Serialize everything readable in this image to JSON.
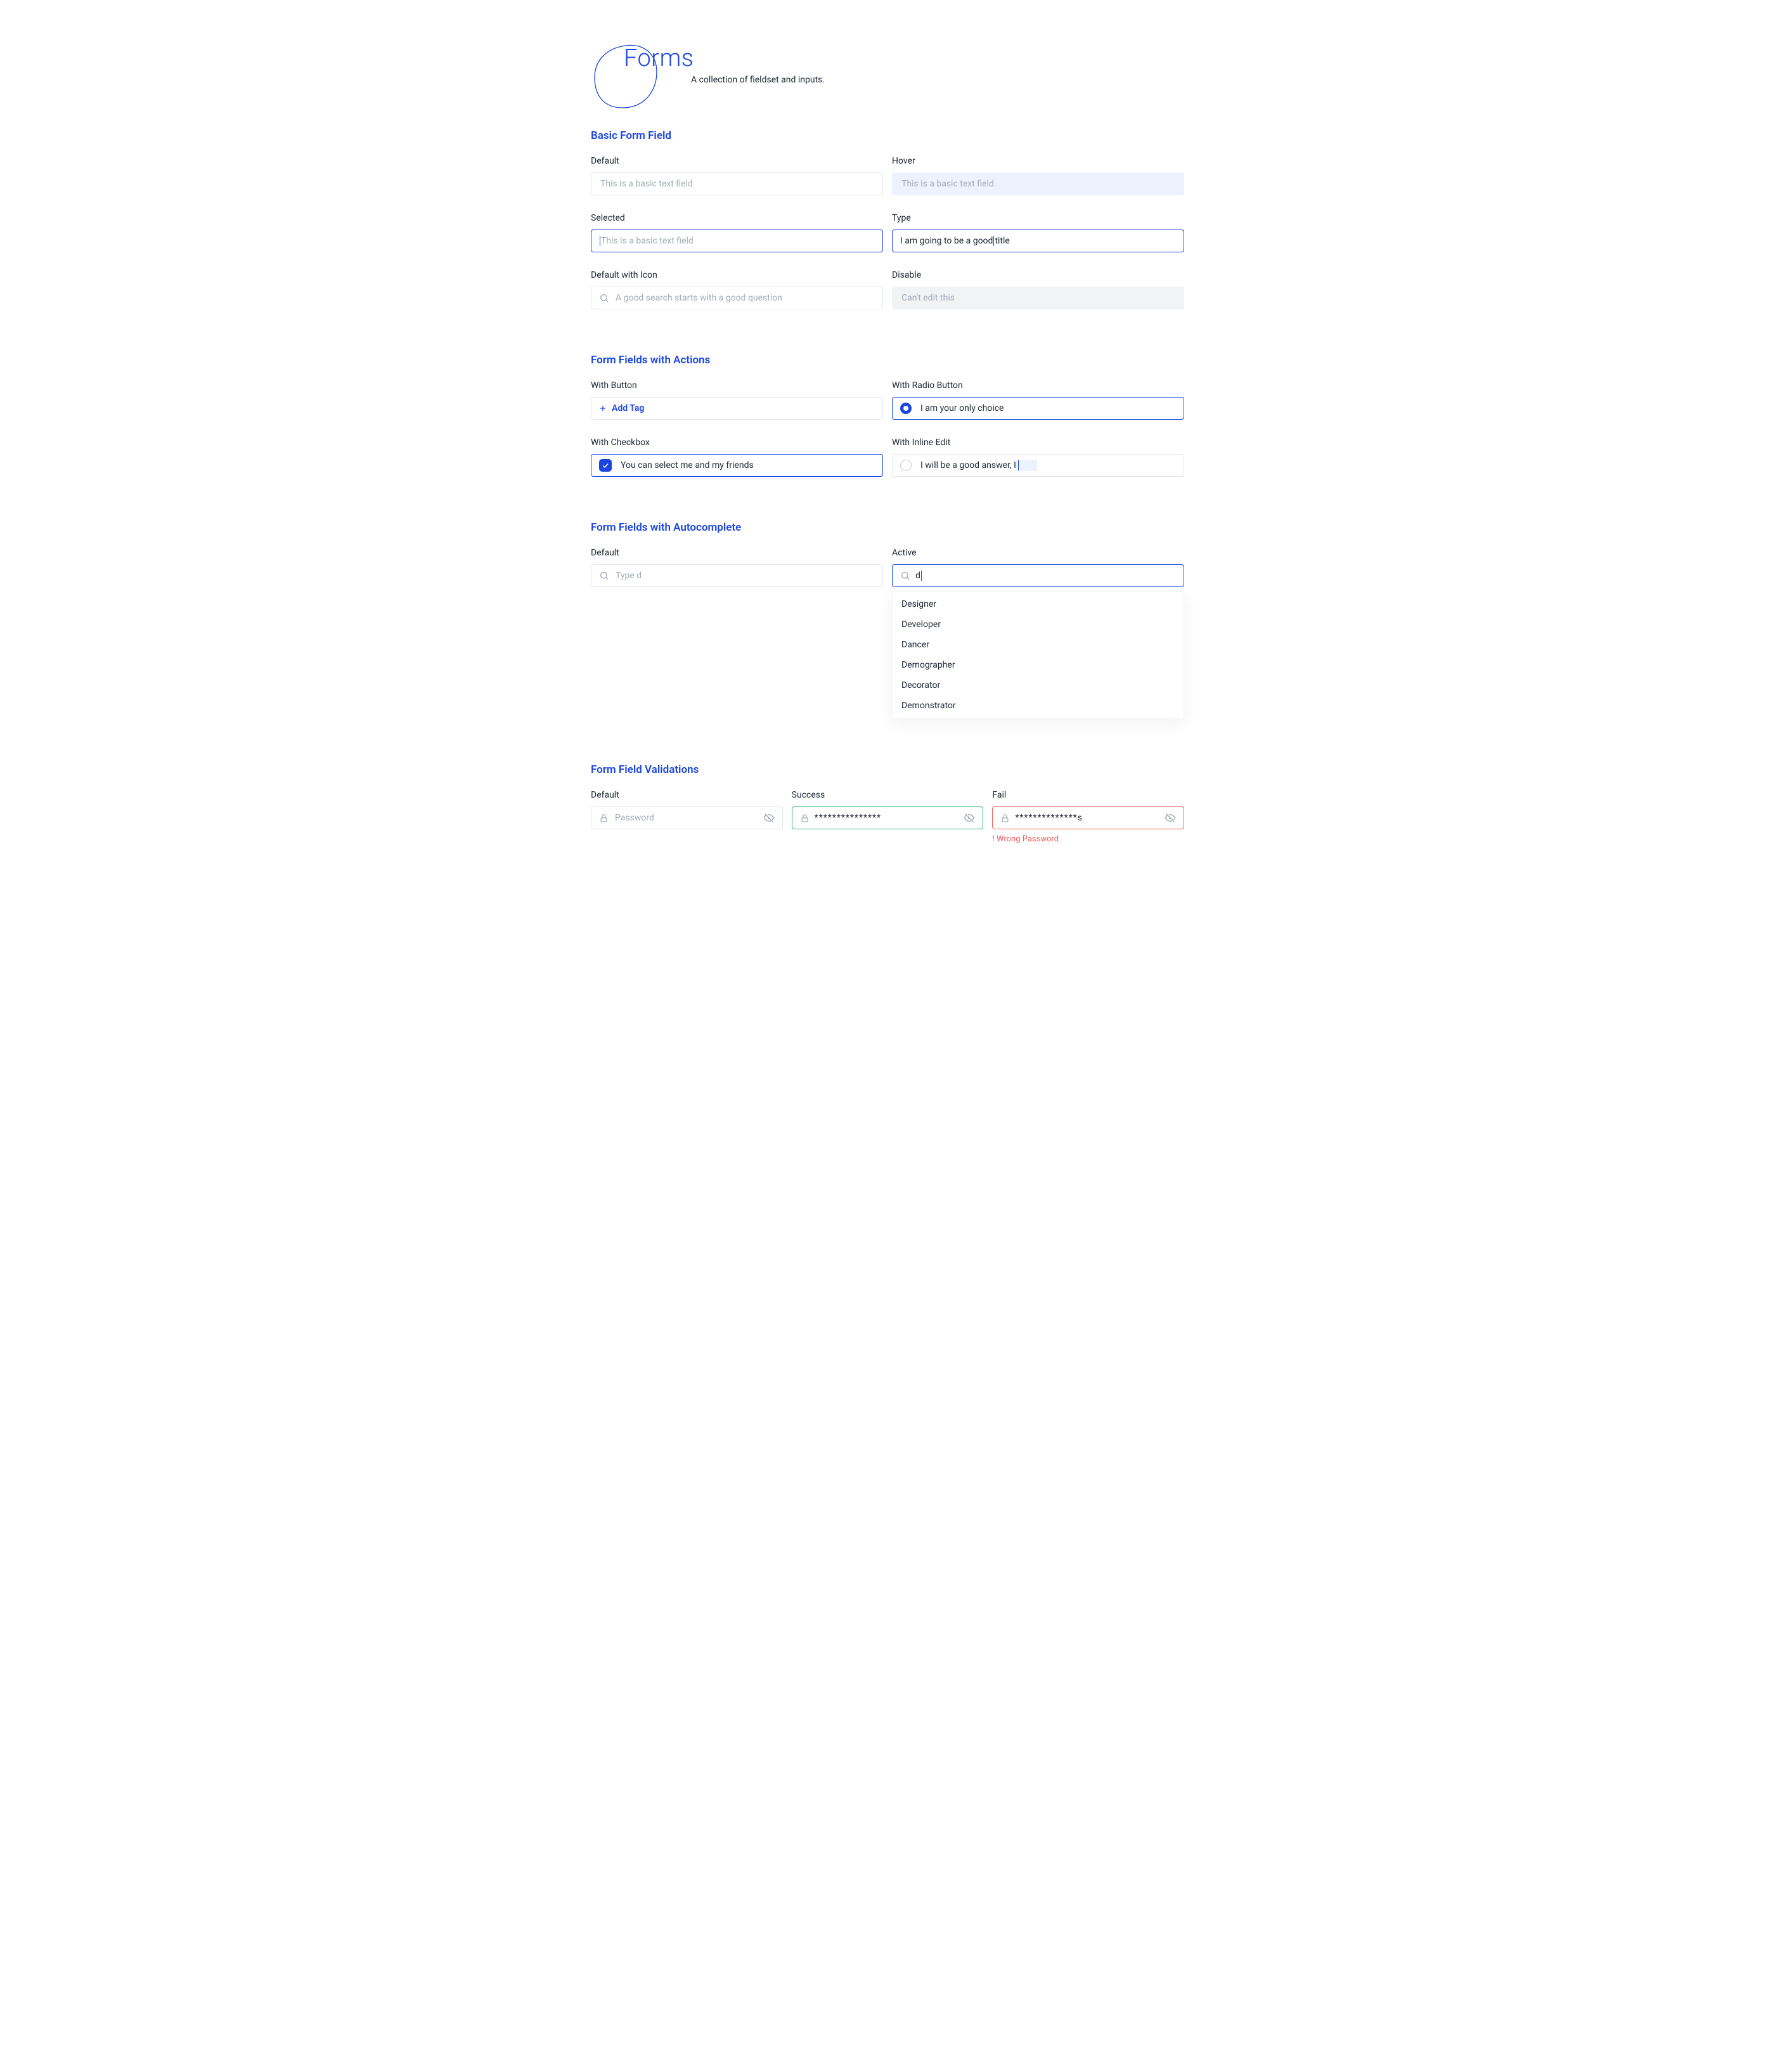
{
  "hero": {
    "title": "Forms",
    "subtitle": "A collection of fieldset and inputs."
  },
  "basic": {
    "title": "Basic Form Field",
    "default": {
      "label": "Default",
      "placeholder": "This is a basic text field"
    },
    "hover": {
      "label": "Hover",
      "placeholder": "This is a basic text field"
    },
    "selected": {
      "label": "Selected",
      "placeholder": "This is a basic text field"
    },
    "type": {
      "label": "Type",
      "before": "I am going to be a good",
      "after": " title"
    },
    "icon": {
      "label": "Default with Icon",
      "placeholder": "A good search starts with a good question"
    },
    "disable": {
      "label": "Disable",
      "value": "Can't edit this"
    }
  },
  "actions": {
    "title": "Form Fields with Actions",
    "button": {
      "label": "With Button",
      "action": "Add Tag"
    },
    "radio": {
      "label": "With Radio Button",
      "text": "I am your only choice"
    },
    "checkbox": {
      "label": "With Checkbox",
      "text": "You can select me and my friends"
    },
    "inline": {
      "label": "With Inline Edit",
      "text": "I will be a good answer, I"
    }
  },
  "autocomplete": {
    "title": "Form Fields with Autocomplete",
    "default": {
      "label": "Default",
      "placeholder": "Type d"
    },
    "active": {
      "label": "Active",
      "value": "d",
      "options": [
        "Designer",
        "Developer",
        "Dancer",
        "Demographer",
        "Decorator",
        "Demonstrator"
      ]
    }
  },
  "validations": {
    "title": "Form Field Validations",
    "default": {
      "label": "Default",
      "placeholder": "Password"
    },
    "success": {
      "label": "Success",
      "value": "***************"
    },
    "fail": {
      "label": "Fail",
      "value": "**************s",
      "error": "! Wrong Password"
    }
  }
}
